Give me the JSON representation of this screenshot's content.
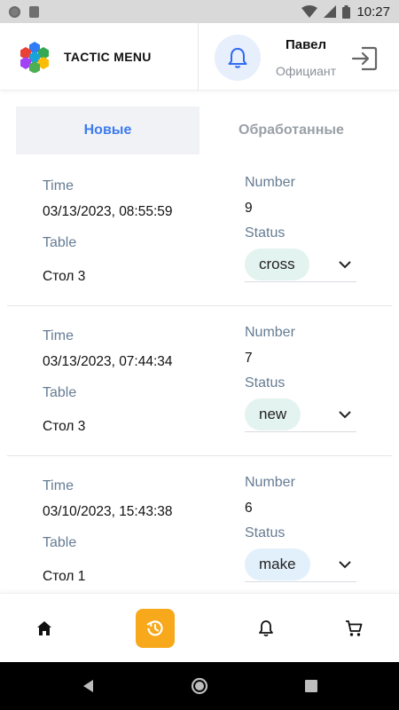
{
  "status_bar": {
    "time": "10:27"
  },
  "header": {
    "brand": "TACTIC MENU",
    "user_name": "Павел",
    "user_role": "Официант"
  },
  "tabs": [
    {
      "label": "Новые",
      "active": true
    },
    {
      "label": "Обработанные",
      "active": false
    }
  ],
  "order_labels": {
    "time": "Time",
    "table": "Table",
    "number": "Number",
    "status": "Status"
  },
  "orders": [
    {
      "time": "03/13/2023, 08:55:59",
      "table": "Стол 3",
      "number": "9",
      "status": "cross",
      "status_color": "#e3f3ef"
    },
    {
      "time": "03/13/2023, 07:44:34",
      "table": "Стол 3",
      "number": "7",
      "status": "new",
      "status_color": "#e3f3ef"
    },
    {
      "time": "03/10/2023, 15:43:38",
      "table": "Стол 1",
      "number": "6",
      "status": "make",
      "status_color": "#e2f0fb"
    }
  ],
  "bottom_nav": [
    {
      "icon": "home-icon",
      "active": false
    },
    {
      "icon": "history-icon",
      "active": true
    },
    {
      "icon": "bell-icon",
      "active": false
    },
    {
      "icon": "cart-icon",
      "active": false
    }
  ],
  "colors": {
    "accent": "#3d7bf0",
    "nav_active": "#f7a81b",
    "label": "#667c93"
  }
}
